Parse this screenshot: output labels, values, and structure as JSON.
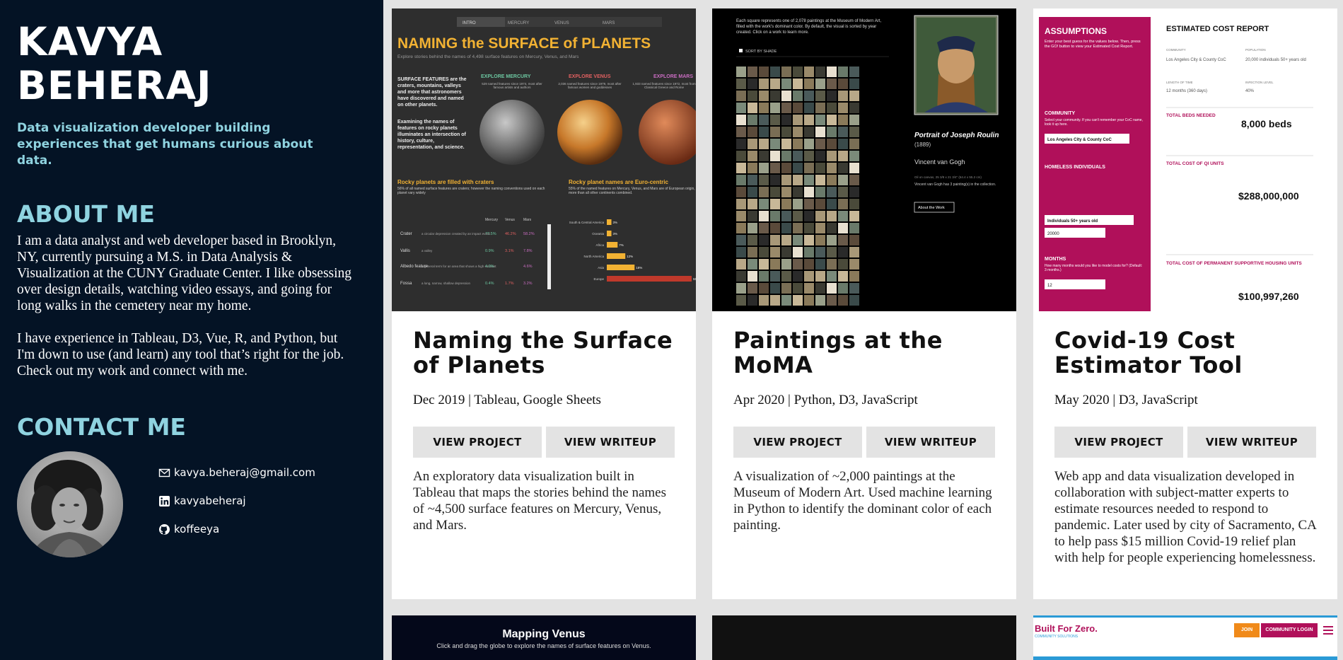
{
  "profile": {
    "name": "KAVYA BEHERAJ",
    "tagline": "Data visualization developer building experiences that get humans curious about data."
  },
  "about": {
    "heading": "ABOUT ME",
    "p1": "I am a data analyst and web developer based in Brooklyn, NY, currently pursuing a M.S. in Data Analysis & Visualization at the CUNY Graduate Center. I like obsessing over design details, watching video essays, and going for long walks in the cemetery near my home.",
    "p2": "I have experience in Tableau, D3, Vue, R, and Python, but I'm down to use (and learn) any tool that’s right for the job. Check out my work and connect with me."
  },
  "contact": {
    "heading": "CONTACT ME",
    "email": "kavya.beheraj@gmail.com",
    "linkedin": "kavyabeheraj",
    "github": "koffeeya"
  },
  "colors": {
    "sidebar_bg": "#041325",
    "accent": "#8fd3e0",
    "card_bg": "#ffffff",
    "page_bg": "#e3e3e3",
    "button_bg": "#e3e3e3"
  },
  "projects": [
    {
      "title": "Naming the Surface of Planets",
      "meta": "Dec 2019 | Tableau, Google Sheets",
      "view_project": "VIEW PROJECT",
      "view_writeup": "VIEW WRITEUP",
      "description": "An exploratory data visualization built in Tableau that maps the stories behind the names of ~4,500 surface features on Mercury, Venus, and Mars.",
      "thumb": {
        "tabs": [
          "INTRO",
          "MERCURY",
          "VENUS",
          "MARS"
        ],
        "title": "NAMING the SURFACE of PLANETS",
        "subtitle": "Explore stories behind the names of 4,498 surface features on Mercury, Venus, and Mars",
        "sidenote": "SURFACE FEATURES are the craters, mountains, valleys and more that astronomers have discovered and named on other planets.",
        "sidenote2": "Examining the names of features on rocky planets illuminates an intersection of history, culture, representation, and science.",
        "planet_labels": [
          "EXPLORE MERCURY",
          "EXPLORE VENUS",
          "EXPLORE MARS"
        ],
        "planet_counts": [
          "529 named features since 1974, most after famous artists and authors",
          "2,036 named features since 1979, most after famous women and goddesses",
          "1,933 named features since 1972, most from Classical Greece and Rome"
        ],
        "craters_heading": "Rocky planets are filled with craters",
        "craters_sub": "56% of all named surface features are craters; however the naming conventions used on each planet vary widely",
        "euro_heading": "Rocky planet names are Euro-centric",
        "euro_sub": "55% of the named features on Mercury, Venus, and Mars are of European origin, more than all other continents combined.",
        "table_headers": [
          "Mercury",
          "Venus",
          "Mars"
        ],
        "table_rows": [
          {
            "name": "Crater",
            "desc": "a circular depression created by an impact event",
            "v": [
              "77.5%",
              "46.2%",
              "58.2%"
            ]
          },
          {
            "name": "Vallis",
            "desc": "a valley",
            "v": [
              "0.9%",
              "3.1%",
              "7.8%"
            ]
          },
          {
            "name": "Albedo feature",
            "desc": "a general term for an area that shows a high contrast",
            "v": [
              "4.0%",
              "",
              "4.6%"
            ]
          },
          {
            "name": "Fossa",
            "desc": "a long, narrow, shallow depression",
            "v": [
              "0.4%",
              "1.7%",
              "3.2%"
            ]
          }
        ],
        "origin_bars": [
          {
            "label": "South & Central America",
            "pct": "3%",
            "value": 3
          },
          {
            "label": "Oceania",
            "pct": "3%",
            "value": 3
          },
          {
            "label": "Africa",
            "pct": "7%",
            "value": 7
          },
          {
            "label": "North America",
            "pct": "12%",
            "value": 12
          },
          {
            "label": "Asia",
            "pct": "18%",
            "value": 18
          },
          {
            "label": "Europe",
            "pct": "55%",
            "value": 55
          }
        ]
      }
    },
    {
      "title": "Paintings at the MoMA",
      "meta": "Apr 2020 | Python, D3, JavaScript",
      "view_project": "VIEW PROJECT",
      "view_writeup": "VIEW WRITEUP",
      "description": "A visualization of ~2,000 paintings at the Museum of Modern Art. Used machine learning in Python to identify the dominant color of each painting.",
      "thumb": {
        "intro": "Each square represents one of 2,078 paintings at the Museum of Modern Art, filled with the work's dominant color. By default, the visual is sorted by year created. Click on a work to learn more.",
        "sort_label": "SORT BY SHADE",
        "painting_title": "Portrait of Joseph Roulin",
        "painting_year": "(1889)",
        "artist": "Vincent van Gogh",
        "medium": "Oil on canvas, 25 3/8 x 21 3/4\" (64.4 x 55.2 cm)",
        "artist_note": "Vincent van Gogh has 3 painting(s) in the collection.",
        "about_button": "About the Work"
      }
    },
    {
      "title": "Covid-19 Cost Estimator Tool",
      "meta": "May 2020 | D3, JavaScript",
      "view_project": "VIEW PROJECT",
      "view_writeup": "VIEW WRITEUP",
      "description": "Web app and data visualization developed in collaboration with subject-matter experts to estimate resources needed to respond to pandemic. Later used by city of Sacramento, CA to help pass $15 million Covid-19 relief plan with help for people experiencing homelessness.",
      "thumb": {
        "assumptions_title": "ASSUMPTIONS",
        "assumptions_text": "Enter your best guess for the values below. Then, press the GO! button to view your Estimated Cost Report.",
        "community_label": "COMMUNITY",
        "community_text": "Select your community. If you can't remember your CoC name, look it up here.",
        "community_value": "Los Angeles City & County CoC",
        "homeless_label": "HOMELESS INDIVIDUALS",
        "homeless_select": "Individuals 50+ years old",
        "homeless_value": "20000",
        "months_label": "MONTHS",
        "months_text": "How many months would you like to model costs for? (Default: 3 months.)",
        "months_value": "12",
        "report_title": "ESTIMATED COST REPORT",
        "community_col": "COMMUNITY",
        "community_col_val": "Los Angeles City & County CoC",
        "population_col": "POPULATION",
        "population_col_val": "20,000 individuals 50+ years old",
        "length_col": "LENGTH OF TIME",
        "length_col_val": "12 months (360 days)",
        "infection_col": "INFECTION LEVEL",
        "infection_col_val": "40%",
        "rows": [
          {
            "label": "TOTAL BEDS NEEDED",
            "value": "8,000 beds"
          },
          {
            "label": "TOTAL COST OF QI UNITS",
            "value": "$288,000,000"
          },
          {
            "label": "TOTAL COST OF PERMANENT SUPPORTIVE HOUSING UNITS",
            "value": "$100,997,260"
          }
        ]
      }
    }
  ],
  "bottom": {
    "venus_title": "Mapping Venus",
    "venus_sub": "Click and drag the globe to explore the names of surface features on Venus.",
    "bfz_logo": "Built For Zero.",
    "bfz_logo_sub": "COMMUNITY SOLUTIONS",
    "bfz_join": "JOIN",
    "bfz_login": "COMMUNITY LOGIN"
  }
}
